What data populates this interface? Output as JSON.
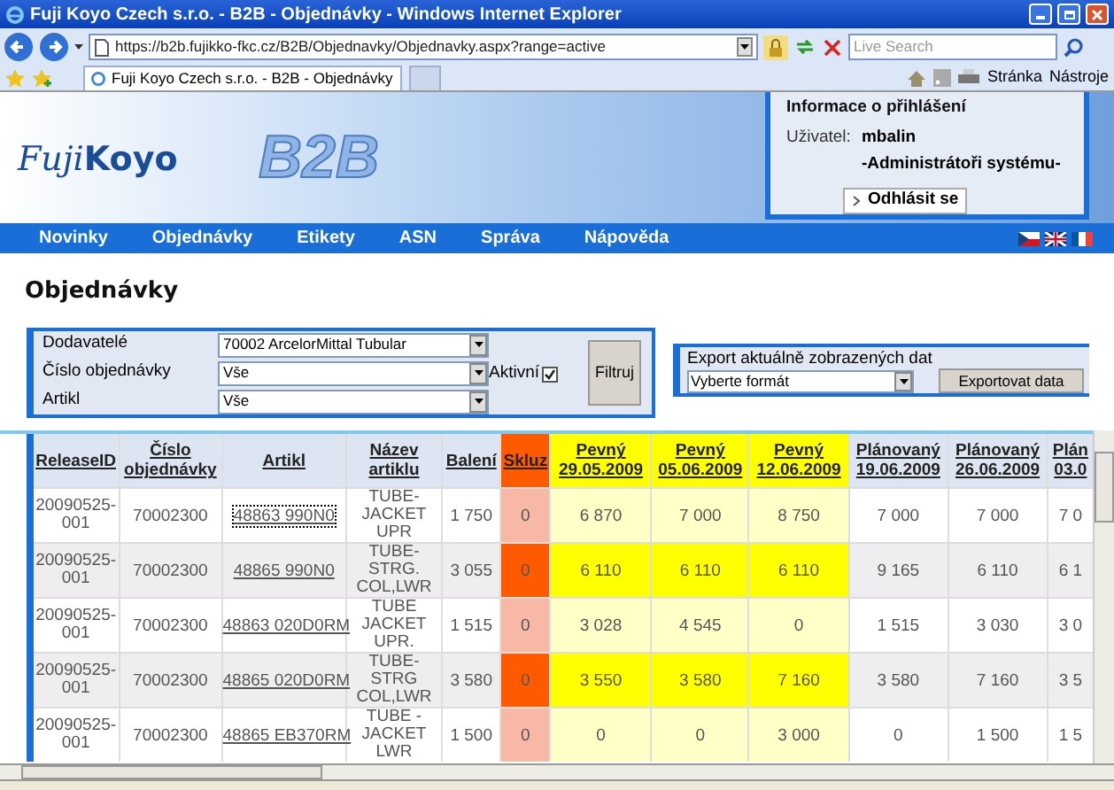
{
  "browser": {
    "title": "Fuji Koyo Czech s.r.o. - B2B - Objednávky - Windows Internet Explorer",
    "url": "https://b2b.fujikko-fkc.cz/B2B/Objednavky/Objednavky.aspx?range=active",
    "search_placeholder": "Live Search",
    "tab": "Fuji Koyo Czech s.r.o. - B2B - Objednávky",
    "menus": [
      "Stránka",
      "Nástroje"
    ]
  },
  "header": {
    "logo_left": "Fuji",
    "logo_right": "Koyo",
    "b2b": "B2B",
    "login": {
      "title": "Informace o přihlášení",
      "user_label": "Uživatel:",
      "user": "mbalin",
      "role": "-Administrátoři systému-",
      "logout": "Odhlásit se"
    }
  },
  "nav": [
    "Novinky",
    "Objednávky",
    "Etikety",
    "ASN",
    "Správa",
    "Nápověda"
  ],
  "page_title": "Objednávky",
  "filter": {
    "fields": [
      {
        "label": "Dodavatelé",
        "value": "70002 ArcelorMittal Tubular"
      },
      {
        "label": "Číslo objednávky",
        "value": "Vše"
      },
      {
        "label": "Artikl",
        "value": "Vše"
      }
    ],
    "active": {
      "label": "Aktivní",
      "checked": true
    },
    "button": "Filtruj"
  },
  "export": {
    "title": "Export aktuálně zobrazených dat",
    "select": "Vyberte formát",
    "button": "Exportovat data"
  },
  "table": {
    "columns": [
      {
        "label": "ReleaseID",
        "kind": "plain"
      },
      {
        "label": "Číslo objednávky",
        "kind": "plain"
      },
      {
        "label": "Artikl",
        "kind": "plain"
      },
      {
        "label": "Název artiklu",
        "kind": "plain"
      },
      {
        "label": "Balení",
        "kind": "plain"
      },
      {
        "label": "Skluz",
        "kind": "slip"
      },
      {
        "label": "Pevný 29.05.2009",
        "kind": "firm"
      },
      {
        "label": "Pevný 05.06.2009",
        "kind": "firm"
      },
      {
        "label": "Pevný 12.06.2009",
        "kind": "firm"
      },
      {
        "label": "Plánovaný 19.06.2009",
        "kind": "planned"
      },
      {
        "label": "Plánovaný 26.06.2009",
        "kind": "planned"
      },
      {
        "label": "Plán 03.0",
        "kind": "planned"
      }
    ],
    "rows": [
      {
        "late": false,
        "focused": true,
        "cells": [
          "20090525-001",
          "70002300",
          "48863 990N0",
          "TUBE-JACKET UPR",
          "1 750",
          "0",
          "6 870",
          "7 000",
          "8 750",
          "7 000",
          "7 000",
          "7 0"
        ]
      },
      {
        "late": true,
        "focused": false,
        "cells": [
          "20090525-001",
          "70002300",
          "48865 990N0",
          "TUBE-STRG. COL,LWR",
          "3 055",
          "0",
          "6 110",
          "6 110",
          "6 110",
          "9 165",
          "6 110",
          "6 1"
        ]
      },
      {
        "late": false,
        "focused": false,
        "cells": [
          "20090525-001",
          "70002300",
          "48863 020D0RM",
          "TUBE JACKET UPR.",
          "1 515",
          "0",
          "3 028",
          "4 545",
          "0",
          "1 515",
          "3 030",
          "3 0"
        ]
      },
      {
        "late": true,
        "focused": false,
        "cells": [
          "20090525-001",
          "70002300",
          "48865 020D0RM",
          "TUBE-STRG COL,LWR",
          "3 580",
          "0",
          "3 550",
          "3 580",
          "7 160",
          "3 580",
          "7 160",
          "3 5"
        ]
      },
      {
        "late": false,
        "focused": false,
        "cells": [
          "20090525-001",
          "70002300",
          "48865 EB370RM",
          "TUBE - JACKET LWR",
          "1 500",
          "0",
          "0",
          "0",
          "3 000",
          "0",
          "1 500",
          "1 5"
        ]
      }
    ]
  }
}
